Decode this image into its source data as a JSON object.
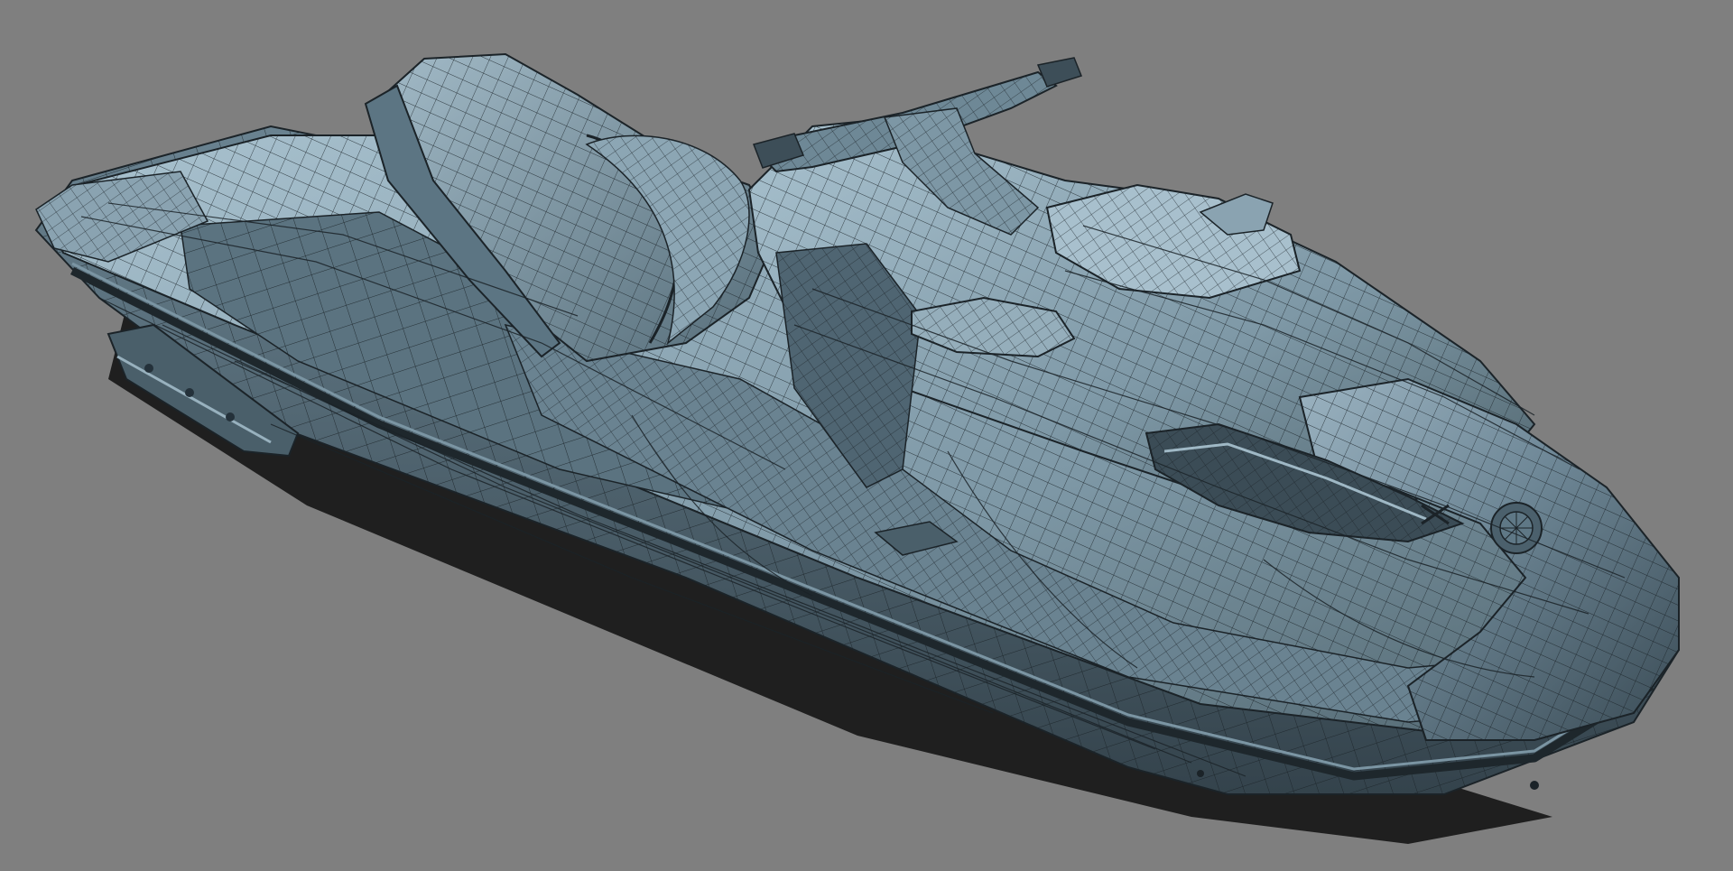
{
  "viewport": {
    "background_color": "#7f7f7f",
    "model": {
      "subject": "jet-ski",
      "display_mode": "wireframe-on-shaded",
      "surface_color": "#5f7886",
      "surface_highlight_color": "#9cb6c4",
      "surface_shadow_color": "#2c3a42",
      "wire_color": "#1b2328",
      "ground_shadow_color": "#151515"
    }
  }
}
